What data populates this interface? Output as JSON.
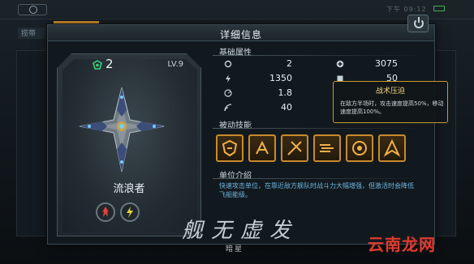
{
  "status_bar": {
    "time_text": "下午 09:12"
  },
  "background": {
    "tab_label": "揽带"
  },
  "panel": {
    "title": "详细信息"
  },
  "unit": {
    "rarity_count": "2",
    "level": "LV.9",
    "name": "流浪者"
  },
  "sections": {
    "basic_stats_label": "基础属性",
    "passive_skills_label": "被动技能",
    "unit_intro_label": "单位介绍"
  },
  "stats": {
    "left": [
      {
        "icon": "cooldown-icon",
        "value": "2"
      },
      {
        "icon": "lightning-icon",
        "value": "1350"
      },
      {
        "icon": "speed-icon",
        "value": "1.8"
      },
      {
        "icon": "range-icon",
        "value": "40"
      }
    ],
    "right": [
      {
        "icon": "health-plus-icon",
        "value": "3075"
      },
      {
        "icon": "armor-icon",
        "value": "50"
      }
    ]
  },
  "tooltip": {
    "title": "战术压迫",
    "text": "在敌方半场时，攻击速度提高50%，移动速度提高100%。"
  },
  "description": "快速攻击单位，在靠近敌方舰队时战斗力大幅增强，但激活时会降低飞船能级。",
  "watermark": {
    "logo": "舰无虚发",
    "sub": "暗星",
    "site": "云南龙网"
  },
  "colors": {
    "accent_orange": "#e6a233",
    "skill_border": "#c98a2c",
    "desc_blue": "#6fb6e0",
    "tooltip_title": "#f2d37a",
    "site_red": "#e23b2e"
  }
}
